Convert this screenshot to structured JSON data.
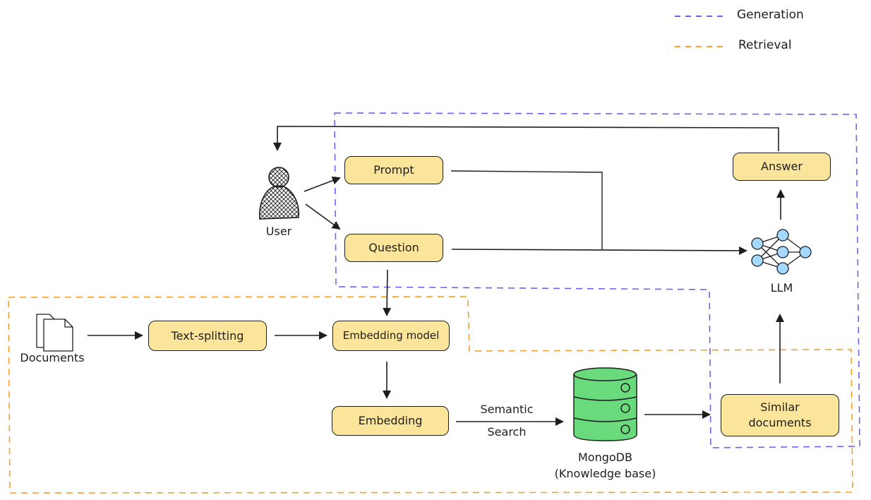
{
  "legend": [
    {
      "label": "Generation",
      "color": "#7b5cf0"
    },
    {
      "label": "Retrieval",
      "color": "#f0a030"
    }
  ],
  "nodes": {
    "prompt": "Prompt",
    "question": "Question",
    "answer": "Answer",
    "text_splitting": "Text-splitting",
    "embedding_model": "Embedding model",
    "embedding": "Embedding",
    "similar_documents": "Similar\ndocuments"
  },
  "icon_labels": {
    "user": "User",
    "documents": "Documents",
    "llm": "LLM",
    "mongodb": "MongoDB",
    "mongodb_sub": "(Knowledge base)"
  },
  "edge_labels": {
    "semantic": "Semantic",
    "search": "Search"
  },
  "colors": {
    "node_fill": "#fbe59a",
    "db_fill": "#69db7c",
    "neuron_fill": "#a5d8ff",
    "stroke": "#1e1e1e"
  }
}
